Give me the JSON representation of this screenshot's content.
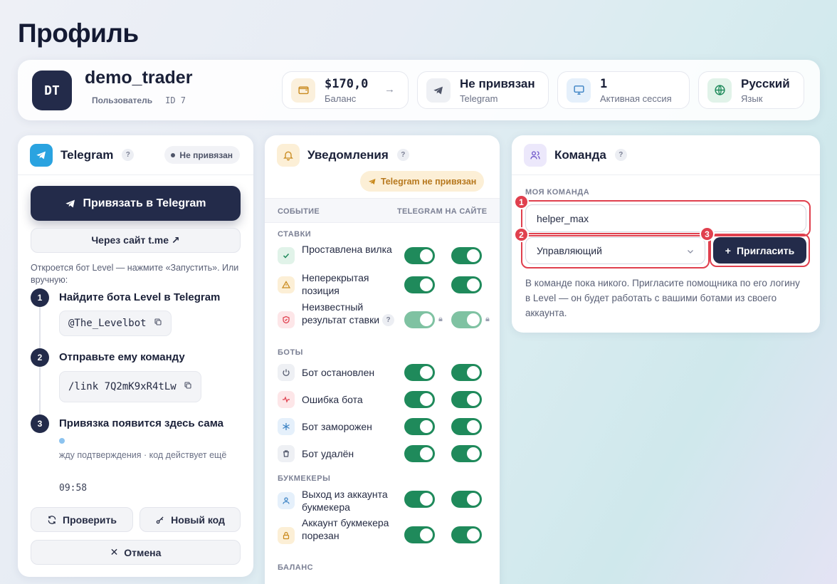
{
  "page": {
    "title": "Профиль"
  },
  "profile": {
    "initials": "DT",
    "username": "demo_trader",
    "role": "Пользователь",
    "id_label": "ID 7"
  },
  "stats": [
    {
      "value": "$170,0",
      "label": "Баланс",
      "icon": "wallet-icon"
    },
    {
      "value": "Не привязан",
      "label": "Telegram",
      "icon": "telegram-icon"
    },
    {
      "value": "1",
      "label": "Активная сессия",
      "icon": "monitor-icon"
    },
    {
      "value": "Русский",
      "label": "Язык",
      "icon": "globe-icon"
    }
  ],
  "telegram": {
    "title": "Telegram",
    "help": "?",
    "status": "Не привязан",
    "link_button": "Привязать в Telegram",
    "via_site_button": "Через сайт t.me ↗",
    "note": "Откроется бот Level — нажмите «Запустить». Или вручную:",
    "steps": [
      {
        "num": "1",
        "title": "Найдите бота Level в Telegram",
        "code": "@The_Levelbot"
      },
      {
        "num": "2",
        "title": "Отправьте ему команду",
        "code": "/link 7Q2mK9xR4tLw"
      },
      {
        "num": "3",
        "title": "Привязка появится здесь сама"
      }
    ],
    "waiting_text": "жду подтверждения · код действует ещё",
    "timer": "09:58",
    "check_button": "Проверить",
    "new_code_button": "Новый код",
    "cancel_button": "Отмена"
  },
  "notifications": {
    "title": "Уведомления",
    "help": "?",
    "warning": "Telegram не привязан",
    "col_event": "СОБЫТИЕ",
    "col_channels": "TELEGRAM НА САЙТЕ",
    "groups": {
      "bets": "СТАВКИ",
      "bots": "БОТЫ",
      "bookmakers": "БУКМЕКЕРЫ",
      "balance": "БАЛАНС"
    },
    "items": [
      {
        "label": "Проставлена вилка",
        "icon": "check-icon",
        "telegram": true,
        "site": true
      },
      {
        "label": "Неперекрытая позиция",
        "icon": "warning-icon",
        "telegram": true,
        "site": true
      },
      {
        "label": "Неизвестный результат ставки",
        "icon": "shield-icon",
        "telegram": true,
        "site": true,
        "locked": true,
        "help": "?"
      },
      {
        "label": "Бот остановлен",
        "icon": "power-icon",
        "telegram": true,
        "site": true
      },
      {
        "label": "Ошибка бота",
        "icon": "pulse-icon",
        "telegram": true,
        "site": true
      },
      {
        "label": "Бот заморожен",
        "icon": "snowflake-icon",
        "telegram": true,
        "site": true
      },
      {
        "label": "Бот удалён",
        "icon": "trash-icon",
        "telegram": true,
        "site": true
      },
      {
        "label": "Выход из аккаунта букмекера",
        "icon": "user-icon",
        "telegram": true,
        "site": true
      },
      {
        "label": "Аккаунт букмекера порезан",
        "icon": "lock-icon",
        "telegram": true,
        "site": true
      }
    ]
  },
  "team": {
    "title": "Команда",
    "help": "?",
    "section_label": "МОЯ КОМАНДА",
    "login_value": "helper_max",
    "role_value": "Управляющий",
    "invite_button": "Пригласить",
    "empty_text": "В команде пока никого. Пригласите помощника по его логину в Level — он будет работать с вашими ботами из своего аккаунта.",
    "annotations": [
      "1",
      "2",
      "3"
    ]
  },
  "colors": {
    "primary": "#232b4a",
    "toggle_on": "#1f8a5b",
    "highlight": "#e0404e",
    "warning_bg": "#fcefd6"
  }
}
